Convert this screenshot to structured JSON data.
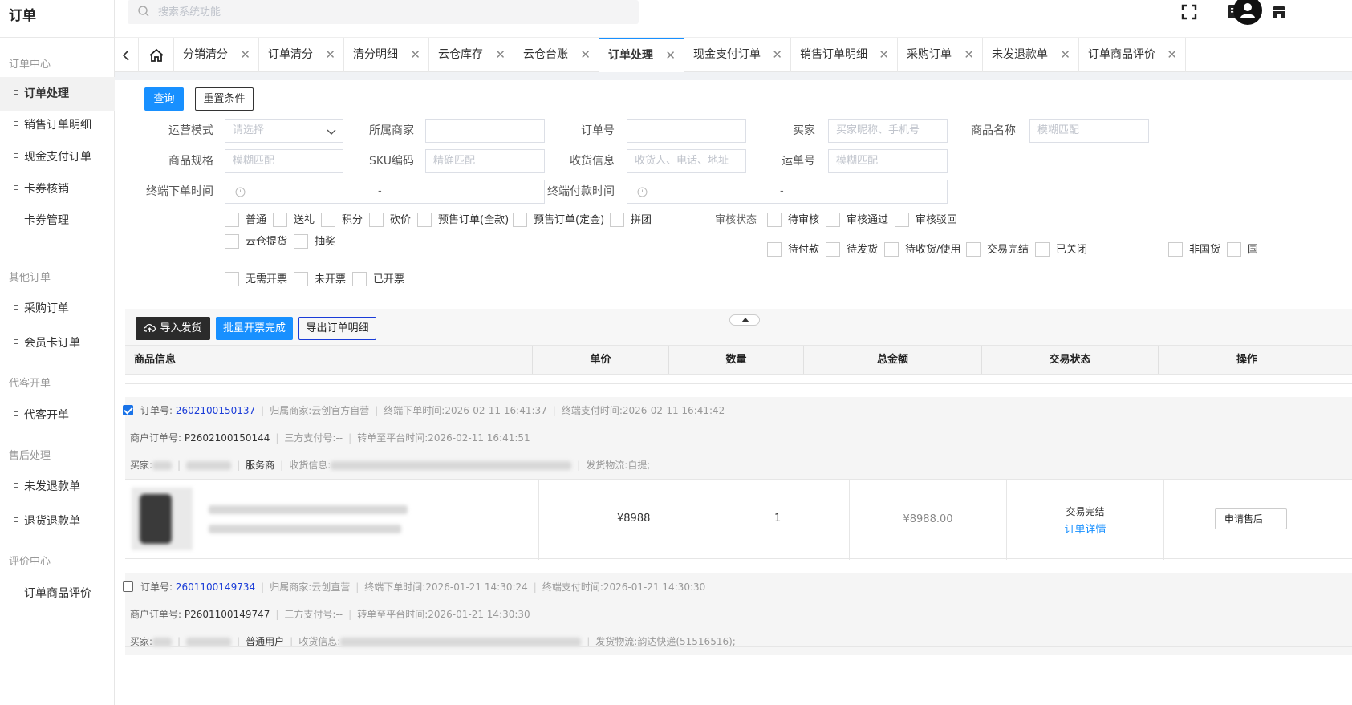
{
  "app": {
    "title": "订单"
  },
  "search": {
    "placeholder": "搜索系统功能"
  },
  "sidebar": {
    "groups": [
      {
        "label": "订单中心"
      },
      {
        "label": "其他订单"
      },
      {
        "label": "代客开单"
      },
      {
        "label": "售后处理"
      },
      {
        "label": "评价中心"
      }
    ],
    "items": [
      {
        "label": "订单处理"
      },
      {
        "label": "销售订单明细"
      },
      {
        "label": "现金支付订单"
      },
      {
        "label": "卡券核销"
      },
      {
        "label": "卡券管理"
      },
      {
        "label": "采购订单"
      },
      {
        "label": "会员卡订单"
      },
      {
        "label": "代客开单"
      },
      {
        "label": "未发退款单"
      },
      {
        "label": "退货退款单"
      },
      {
        "label": "订单商品评价"
      }
    ]
  },
  "tabs": [
    {
      "label": "分销清分"
    },
    {
      "label": "订单清分"
    },
    {
      "label": "清分明细"
    },
    {
      "label": "云仓库存"
    },
    {
      "label": "云仓台账"
    },
    {
      "label": "订单处理"
    },
    {
      "label": "现金支付订单"
    },
    {
      "label": "销售订单明细"
    },
    {
      "label": "采购订单"
    },
    {
      "label": "未发退款单"
    },
    {
      "label": "订单商品评价"
    }
  ],
  "filters": {
    "query_btn": "查询",
    "reset_btn": "重置条件",
    "labels": {
      "mode": "运营模式",
      "merchant": "所属商家",
      "order_no": "订单号",
      "buyer": "买家",
      "product_name": "商品名称",
      "spec": "商品规格",
      "sku": "SKU编码",
      "receiver": "收货信息",
      "waybill": "运单号",
      "order_time": "终端下单时间",
      "pay_time": "终端付款时间",
      "audit_status": "审核状态"
    },
    "placeholders": {
      "mode": "请选择",
      "buyer": "买家昵称、手机号",
      "product_name": "模糊匹配",
      "spec": "模糊匹配",
      "sku": "精确匹配",
      "receiver": "收货人、电话、地址",
      "waybill": "模糊匹配",
      "range_sep": "-"
    },
    "order_types": [
      "普通",
      "送礼",
      "积分",
      "砍价",
      "预售订单(全款)",
      "预售订单(定金)",
      "拼团",
      "云仓提货",
      "抽奖"
    ],
    "audit": [
      "待审核",
      "审核通过",
      "审核驳回"
    ],
    "trade_status": [
      "待付款",
      "待发货",
      "待收货/使用",
      "交易完结",
      "已关闭"
    ],
    "goods_type": [
      "非国货",
      "国"
    ],
    "invoice": [
      "无需开票",
      "未开票",
      "已开票"
    ]
  },
  "toolbar": {
    "import_btn": "导入发货",
    "batch_invoice_btn": "批量开票完成",
    "export_btn": "导出订单明细"
  },
  "table": {
    "columns": [
      "商品信息",
      "单价",
      "数量",
      "总金额",
      "交易状态",
      "操作"
    ]
  },
  "orders": [
    {
      "checked": true,
      "order_no_label": "订单号:",
      "order_no": "2602100150137",
      "merchant": "归属商家:云创官方自营",
      "order_time": "终端下单时间:2026-02-11 16:41:37",
      "pay_time": "终端支付时间:2026-02-11 16:41:42",
      "merchant_order_label": "商户订单号:",
      "merchant_order": "P2602100150144",
      "third_pay": "三方支付号:--",
      "transfer_time": "转单至平台时间:2026-02-11 16:41:51",
      "buyer_label": "买家:",
      "buyer_type": "服务商",
      "receiver_label": "收货信息:",
      "logistics": "发货物流:自提;",
      "price": "¥8988",
      "qty": "1",
      "total": "¥8988.00",
      "status": "交易完结",
      "detail_link": "订单详情",
      "action_btn": "申请售后"
    },
    {
      "checked": false,
      "order_no_label": "订单号:",
      "order_no": "2601100149734",
      "merchant": "归属商家:云创直营",
      "order_time": "终端下单时间:2026-01-21 14:30:24",
      "pay_time": "终端支付时间:2026-01-21 14:30:30",
      "merchant_order_label": "商户订单号:",
      "merchant_order": "P2601100149747",
      "third_pay": "三方支付号:--",
      "transfer_time": "转单至平台时间:2026-01-21 14:30:30",
      "buyer_label": "买家:",
      "buyer_type": "普通用户",
      "receiver_label": "收货信息:",
      "logistics": "发货物流:韵达快递(51516516);"
    }
  ]
}
